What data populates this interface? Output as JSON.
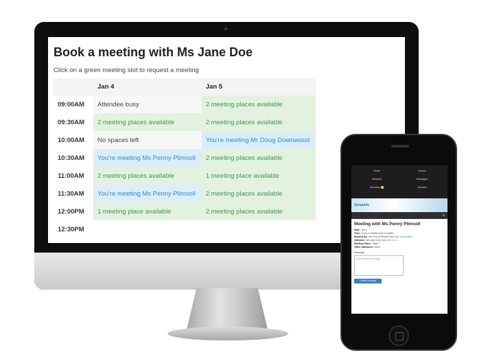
{
  "desktop": {
    "title": "Book a meeting with Ms Jane Doe",
    "instruction": "Click on a green meeting slot to request a meeting",
    "columns": [
      "Jan 4",
      "Jan 5"
    ],
    "rows": [
      {
        "time": "09:00AM",
        "jan4": "Attendee busy",
        "jan4_status": "busy",
        "jan5": "2 meeting places available",
        "jan5_status": "open"
      },
      {
        "time": "09:30AM",
        "jan4": "2 meeting places available",
        "jan4_status": "open",
        "jan5": "2 meeting places available",
        "jan5_status": "open"
      },
      {
        "time": "10:00AM",
        "jan4": "No spaces left",
        "jan4_status": "busy",
        "jan5": "You're meeting Mr Doug Downwood",
        "jan5_status": "mine"
      },
      {
        "time": "10:30AM",
        "jan4": "You're meeting Ms Penny Plimsoll",
        "jan4_status": "mine",
        "jan5": "2 meeting places available",
        "jan5_status": "open"
      },
      {
        "time": "11:00AM",
        "jan4": "2 meeting places available",
        "jan4_status": "open",
        "jan5": "1 meeting place available",
        "jan5_status": "open"
      },
      {
        "time": "11:30AM",
        "jan4": "You're meeting Ms Penny Plimsoll",
        "jan4_status": "mine",
        "jan5": "2 meeting places available",
        "jan5_status": "open"
      },
      {
        "time": "12:00PM",
        "jan4": "1 meeting place available",
        "jan4_status": "open",
        "jan5": "2 meeting places available",
        "jan5_status": "open"
      },
      {
        "time": "12:30PM",
        "jan4": "",
        "jan4_status": "empty",
        "jan5": "",
        "jan5_status": "empty"
      }
    ],
    "colors": {
      "open_bg": "#e3f2df",
      "open_text": "#3a9a4a",
      "mine_bg": "#dcedf8",
      "mine_text": "#2c8fcf"
    }
  },
  "phone": {
    "nav": [
      "Home",
      "Search",
      "Sessions",
      "Messages",
      "Schedule",
      "Account"
    ],
    "schedule_badge": "2",
    "banner": "Semantic",
    "menu_icon": "≡",
    "title": "Meeting with Ms Penny Plimsoll",
    "fields": [
      {
        "label": "Date:",
        "value": "Jan 4"
      },
      {
        "label": "Time:",
        "value": "From 10:30AM until 10:45AM"
      },
      {
        "label": "Booked by:",
        "value": "Ms Penny Plimsoll from",
        "link": "ABC Associates"
      },
      {
        "label": "Attendee:",
        "value": "Ms Jane Doe from",
        "link": "Doe & Co"
      },
      {
        "label": "Meeting Place:",
        "value": "Table 7"
      },
      {
        "label": "Other attendees:",
        "value": "None"
      }
    ],
    "message_label": "Message:",
    "message_value": "Look forward to meeting!",
    "button_label": "Confirm booking"
  }
}
